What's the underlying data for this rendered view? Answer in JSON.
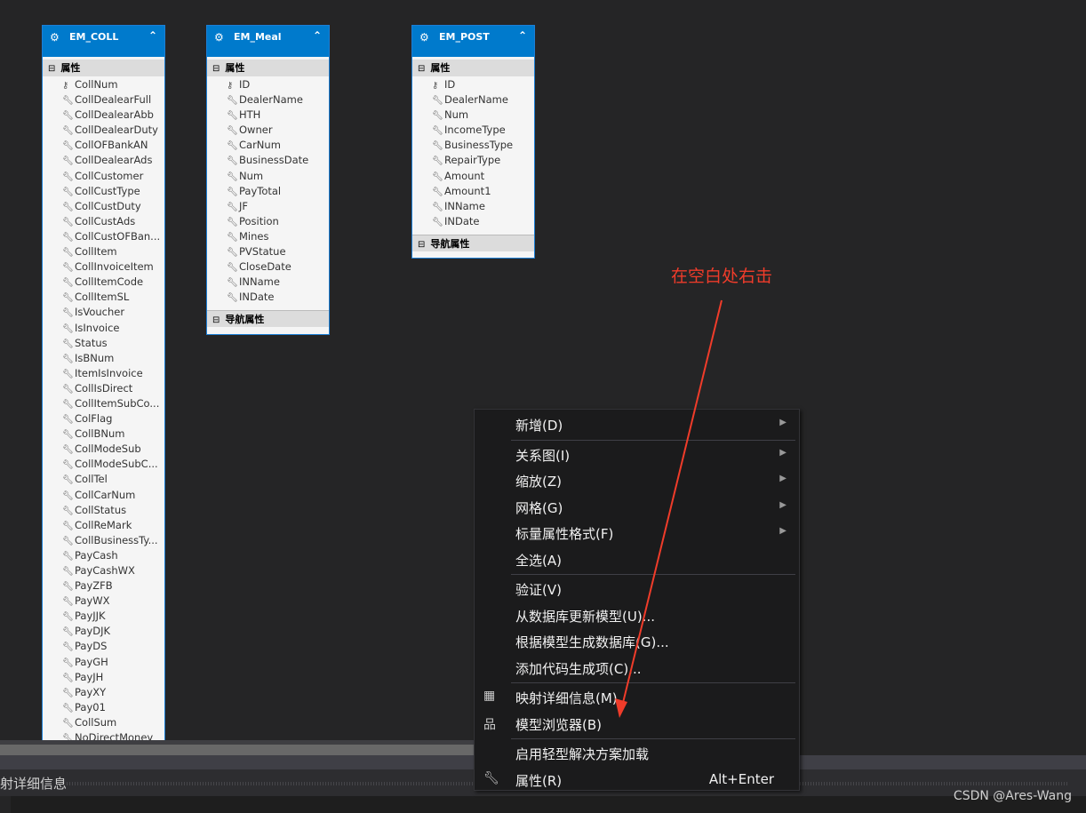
{
  "entities": [
    {
      "title": "EM_COLL",
      "section": "属性",
      "nav": "",
      "key": "CollNum",
      "props": [
        "CollDealearFull",
        "CollDealearAbb",
        "CollDealearDuty",
        "CollOFBankAN",
        "CollDealearAds",
        "CollCustomer",
        "CollCustType",
        "CollCustDuty",
        "CollCustAds",
        "CollCustOFBan...",
        "CollItem",
        "CollInvoiceItem",
        "CollItemCode",
        "CollItemSL",
        "IsVoucher",
        "IsInvoice",
        "Status",
        "IsBNum",
        "ItemIsInvoice",
        "CollIsDirect",
        "CollItemSubCo...",
        "ColFlag",
        "CollBNum",
        "CollModeSub",
        "CollModeSubC...",
        "CollTel",
        "CollCarNum",
        "CollStatus",
        "CollReMark",
        "CollBusinessTy...",
        "PayCash",
        "PayCashWX",
        "PayZFB",
        "PayWX",
        "PayJJK",
        "PayDJK",
        "PayDS",
        "PayGH",
        "PayJH",
        "PayXY",
        "Pay01",
        "CollSum",
        "NoDirectMoney"
      ]
    },
    {
      "title": "EM_Meal",
      "section": "属性",
      "nav": "导航属性",
      "key": "ID",
      "props": [
        "DealerName",
        "HTH",
        "Owner",
        "CarNum",
        "BusinessDate",
        "Num",
        "PayTotal",
        "JF",
        "Position",
        "Mines",
        "PVStatue",
        "CloseDate",
        "INName",
        "INDate"
      ]
    },
    {
      "title": "EM_POST",
      "section": "属性",
      "nav": "导航属性",
      "key": "ID",
      "props": [
        "DealerName",
        "Num",
        "IncomeType",
        "BusinessType",
        "RepairType",
        "Amount",
        "Amount1",
        "INName",
        "INDate"
      ]
    }
  ],
  "context_menu": [
    {
      "label": "新增(D)",
      "submenu": true
    },
    {
      "sep": true
    },
    {
      "label": "关系图(I)",
      "submenu": true
    },
    {
      "label": "缩放(Z)",
      "submenu": true
    },
    {
      "label": "网格(G)",
      "submenu": true
    },
    {
      "label": "标量属性格式(F)",
      "submenu": true
    },
    {
      "label": "全选(A)"
    },
    {
      "sep": true
    },
    {
      "label": "验证(V)"
    },
    {
      "label": "从数据库更新模型(U)..."
    },
    {
      "label": "根据模型生成数据库(G)..."
    },
    {
      "label": "添加代码生成项(C)..."
    },
    {
      "sep": true
    },
    {
      "label": "映射详细信息(M)",
      "icon": "mapping-details-icon"
    },
    {
      "label": "模型浏览器(B)",
      "icon": "model-browser-icon"
    },
    {
      "sep": true
    },
    {
      "label": "启用轻型解决方案加载"
    },
    {
      "label": "属性(R)",
      "icon": "wrench-icon",
      "shortcut": "Alt+Enter"
    }
  ],
  "panel_title": "射详细信息",
  "annotation": "在空白处右击",
  "annotation_color": "#f03c2a",
  "watermark": "CSDN @Ares-Wang",
  "accent": "#007acc"
}
